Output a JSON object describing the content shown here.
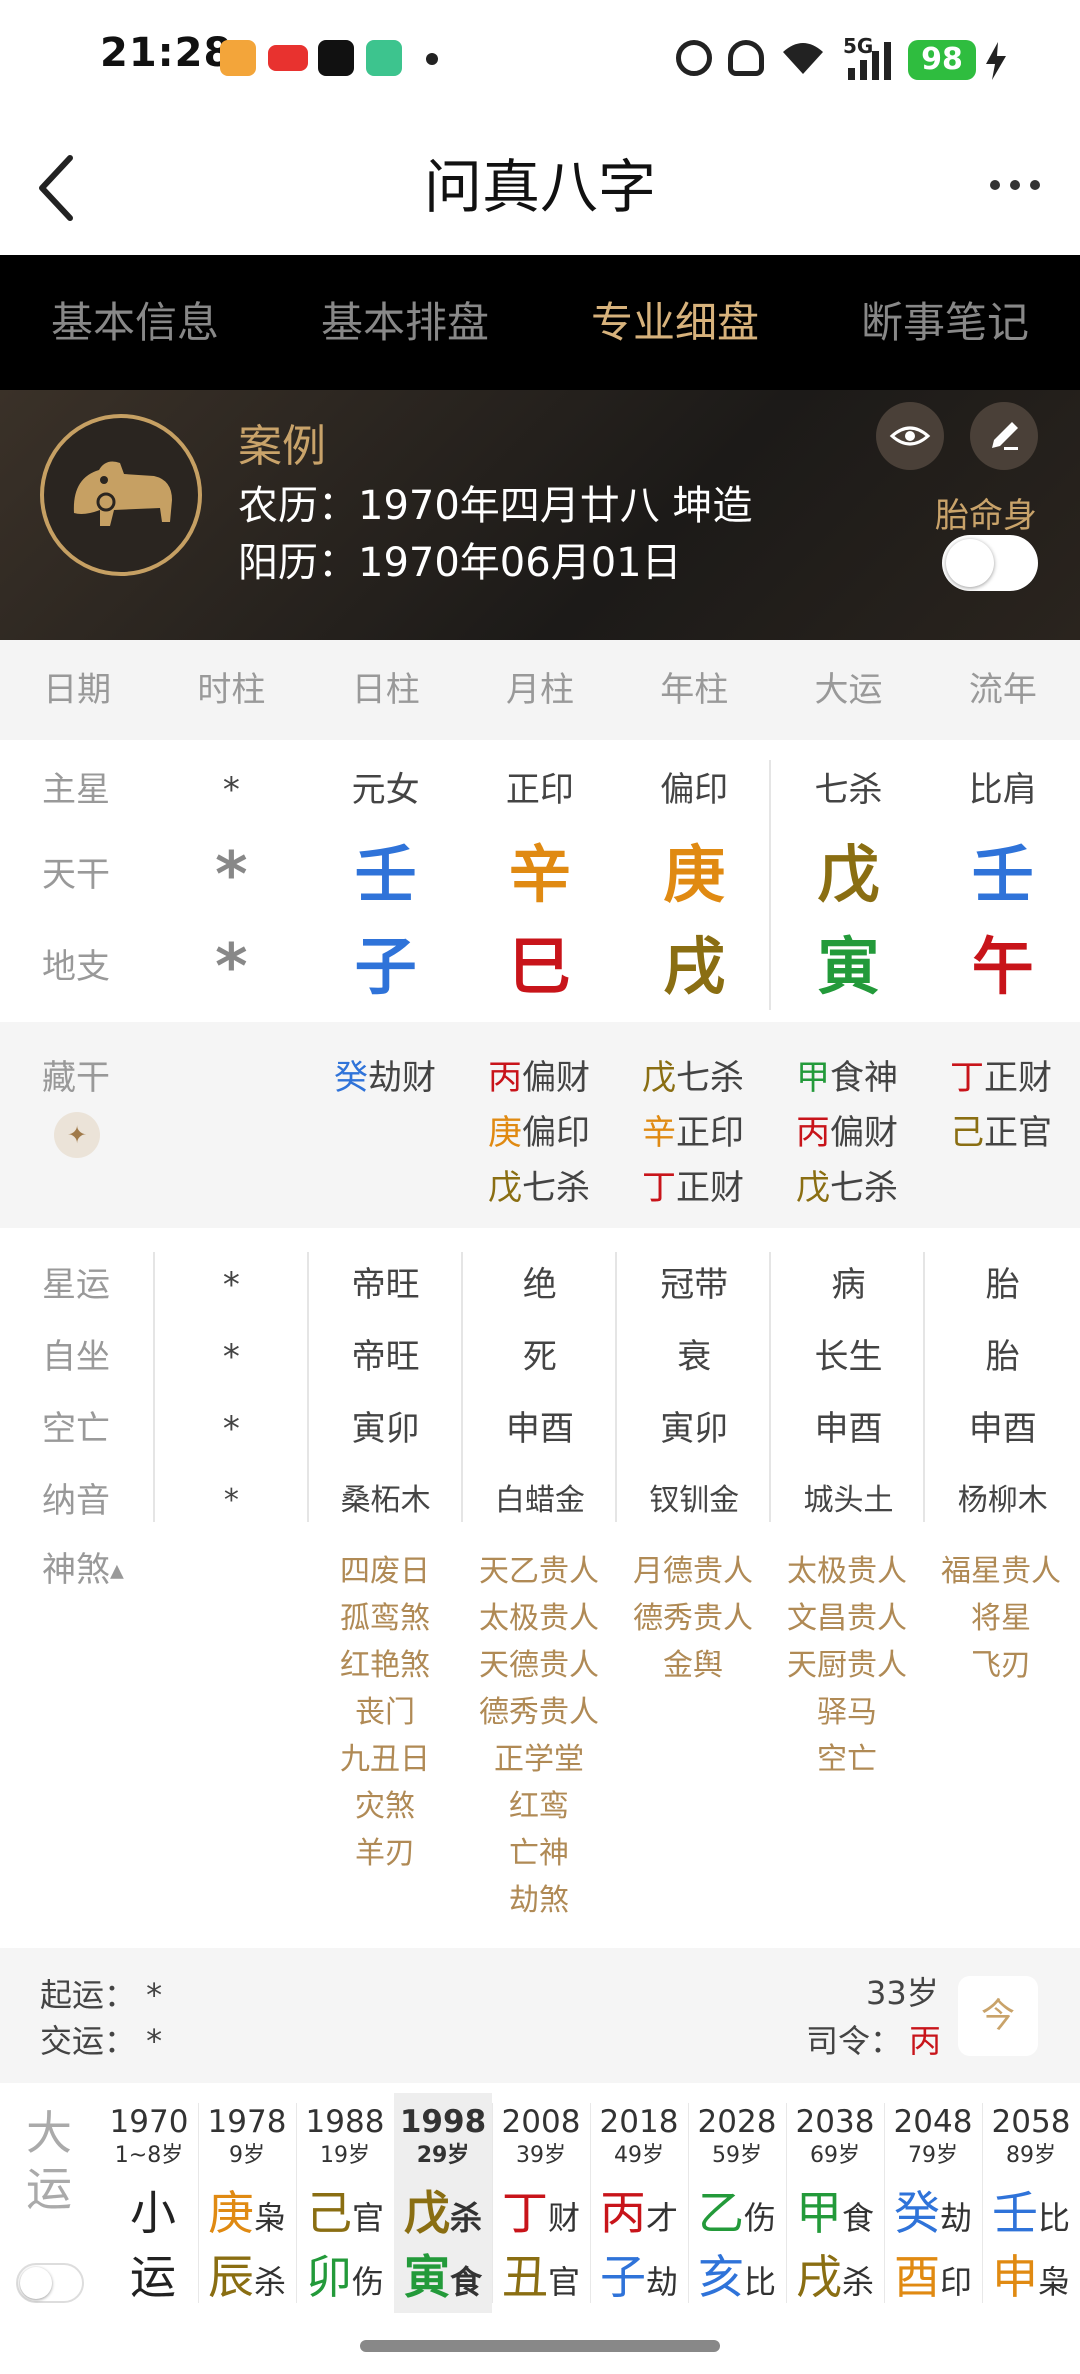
{
  "status_bar": {
    "time": "21:28",
    "battery": "98",
    "network": "5G"
  },
  "header": {
    "title": "问真八字"
  },
  "tabs": [
    "基本信息",
    "基本排盘",
    "专业细盘",
    "断事笔记"
  ],
  "active_tab": "专业细盘",
  "profile": {
    "name": "案例",
    "lunar_label": "农历：",
    "lunar_value": "1970年四月廿八  坤造",
    "solar_label": "阳历：",
    "solar_value": "1970年06月01日",
    "taiming_label": "胎命身"
  },
  "pillars_header": [
    "日期",
    "时柱",
    "日柱",
    "月柱",
    "年柱",
    "大运",
    "流年"
  ],
  "rows": {
    "zhuxing": {
      "label": "主星",
      "values": [
        "*",
        "元女",
        "正印",
        "偏印",
        "七杀",
        "比肩"
      ]
    },
    "tiangan": {
      "label": "天干",
      "values": [
        "*",
        "壬",
        "辛",
        "庚",
        "戊",
        "壬"
      ],
      "colors": [
        "star",
        "blue",
        "orange",
        "orange",
        "olive",
        "blue"
      ]
    },
    "dizhi": {
      "label": "地支",
      "values": [
        "*",
        "子",
        "巳",
        "戌",
        "寅",
        "午"
      ],
      "colors": [
        "star",
        "blue",
        "red",
        "olive",
        "green",
        "red"
      ]
    }
  },
  "canggan": {
    "label": "藏干",
    "columns": [
      [
        {
          "g": "癸",
          "c": "blue",
          "s": "劫财"
        }
      ],
      [
        {
          "g": "丙",
          "c": "red",
          "s": "偏财"
        },
        {
          "g": "庚",
          "c": "orange",
          "s": "偏印"
        },
        {
          "g": "戊",
          "c": "olive",
          "s": "七杀"
        }
      ],
      [
        {
          "g": "戊",
          "c": "olive",
          "s": "七杀"
        },
        {
          "g": "辛",
          "c": "orange",
          "s": "正印"
        },
        {
          "g": "丁",
          "c": "red",
          "s": "正财"
        }
      ],
      [
        {
          "g": "甲",
          "c": "green",
          "s": "食神"
        },
        {
          "g": "丙",
          "c": "red",
          "s": "偏财"
        },
        {
          "g": "戊",
          "c": "olive",
          "s": "七杀"
        }
      ],
      [
        {
          "g": "丁",
          "c": "red",
          "s": "正财"
        },
        {
          "g": "己",
          "c": "olive",
          "s": "正官"
        }
      ]
    ]
  },
  "info_rows": [
    {
      "label": "星运",
      "values": [
        "*",
        "帝旺",
        "绝",
        "冠带",
        "病",
        "胎"
      ]
    },
    {
      "label": "自坐",
      "values": [
        "*",
        "帝旺",
        "死",
        "衰",
        "长生",
        "胎"
      ]
    },
    {
      "label": "空亡",
      "values": [
        "*",
        "寅卯",
        "申酉",
        "寅卯",
        "申酉",
        "申酉"
      ]
    },
    {
      "label": "纳音",
      "values": [
        "*",
        "桑柘木",
        "白蜡金",
        "钗钏金",
        "城头土",
        "杨柳木"
      ]
    }
  ],
  "shensha": {
    "label": "神煞",
    "columns": [
      [
        "四废日",
        "孤鸾煞",
        "红艳煞",
        "丧门",
        "九丑日",
        "灾煞",
        "羊刃"
      ],
      [
        "天乙贵人",
        "太极贵人",
        "天德贵人",
        "德秀贵人",
        "正学堂",
        "红鸾",
        "亡神",
        "劫煞"
      ],
      [
        "月德贵人",
        "德秀贵人",
        "金舆"
      ],
      [
        "太极贵人",
        "文昌贵人",
        "天厨贵人",
        "驿马",
        "空亡"
      ],
      [
        "福星贵人",
        "将星",
        "飞刃"
      ]
    ]
  },
  "qiyun": {
    "qiyun": "起运：  *",
    "jiaoyun": "交运：  *",
    "age": "33岁",
    "siling_label": "司令：",
    "siling_value": "丙",
    "cal_icon": "今"
  },
  "dayun": {
    "label": "大运",
    "columns": [
      {
        "year": "1970",
        "age": "1~8岁",
        "top": "小",
        "bottom": "运",
        "tc": "black",
        "bc": "black",
        "ts": "",
        "bs": ""
      },
      {
        "year": "1978",
        "age": "9岁",
        "top": "庚",
        "ts": "枭",
        "tc": "orange",
        "bottom": "辰",
        "bs": "杀",
        "bc": "olive"
      },
      {
        "year": "1988",
        "age": "19岁",
        "top": "己",
        "ts": "官",
        "tc": "olive",
        "bottom": "卯",
        "bs": "伤",
        "bc": "green"
      },
      {
        "year": "1998",
        "age": "29岁",
        "top": "戊",
        "ts": "杀",
        "tc": "olive",
        "bottom": "寅",
        "bs": "食",
        "bc": "green"
      },
      {
        "year": "2008",
        "age": "39岁",
        "top": "丁",
        "ts": "财",
        "tc": "red",
        "bottom": "丑",
        "bs": "官",
        "bc": "olive"
      },
      {
        "year": "2018",
        "age": "49岁",
        "top": "丙",
        "ts": "才",
        "tc": "red",
        "bottom": "子",
        "bs": "劫",
        "bc": "blue"
      },
      {
        "year": "2028",
        "age": "59岁",
        "top": "乙",
        "ts": "伤",
        "tc": "green",
        "bottom": "亥",
        "bs": "比",
        "bc": "blue"
      },
      {
        "year": "2038",
        "age": "69岁",
        "top": "甲",
        "ts": "食",
        "tc": "green",
        "bottom": "戌",
        "bs": "杀",
        "bc": "olive"
      },
      {
        "year": "2048",
        "age": "79岁",
        "top": "癸",
        "ts": "劫",
        "tc": "blue",
        "bottom": "酉",
        "bs": "印",
        "bc": "orange"
      },
      {
        "year": "2058",
        "age": "89岁",
        "top": "壬",
        "ts": "比",
        "tc": "blue",
        "bottom": "申",
        "bs": "枭",
        "bc": "orange"
      }
    ],
    "active_index": 3
  },
  "colors": {
    "blue": "#2f73d9",
    "orange": "#e08a12",
    "olive": "#8a6e12",
    "green": "#239a3a",
    "red": "#c8141a",
    "gold": "#c9a36a"
  }
}
